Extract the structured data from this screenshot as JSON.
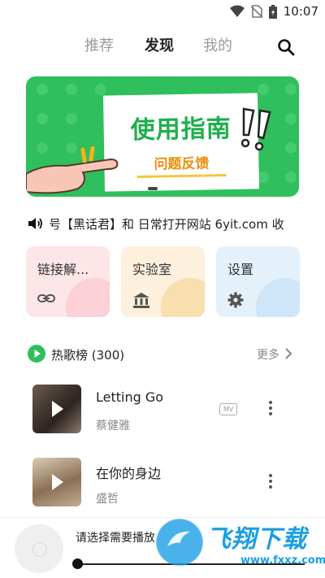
{
  "status_bar": {
    "time": "10:07",
    "icons": [
      "wifi-icon",
      "no-sim-icon",
      "battery-icon"
    ]
  },
  "nav": {
    "tabs": [
      {
        "label": "推荐",
        "active": false
      },
      {
        "label": "发现",
        "active": true
      },
      {
        "label": "我的",
        "active": false
      }
    ],
    "search_icon": "search-icon"
  },
  "banner": {
    "title": "使用指南",
    "subtitle": "问题反馈",
    "colors": {
      "background": "#2fbf5c",
      "title": "#1fae4e",
      "subtitle": "#e8900a"
    }
  },
  "announcement": {
    "icon": "speaker-icon",
    "text": "号【黑话君】和 日常打开网站 6yit.com 收"
  },
  "tools": [
    {
      "label": "链接解...",
      "icon": "link-icon",
      "bg": "#fde6e8",
      "deco": "#fbd0d6"
    },
    {
      "label": "实验室",
      "icon": "bank-icon",
      "bg": "#fdf0dc",
      "deco": "#f7dfae"
    },
    {
      "label": "设置",
      "icon": "gear-icon",
      "bg": "#e4f1fb",
      "deco": "#cfe6f8"
    }
  ],
  "hot_list": {
    "title": "热歌榜 (300)",
    "more_label": "更多",
    "accent": "#2fbf5c",
    "songs": [
      {
        "name": "Letting Go",
        "artist": "蔡健雅",
        "mv": "MV",
        "has_mv": true
      },
      {
        "name": "在你的身边",
        "artist": "盛哲",
        "mv": "",
        "has_mv": false
      }
    ]
  },
  "player": {
    "prompt": "请选择需要播放"
  },
  "watermark": {
    "text": "飞翔下载",
    "url": "www.fxxz.com"
  }
}
